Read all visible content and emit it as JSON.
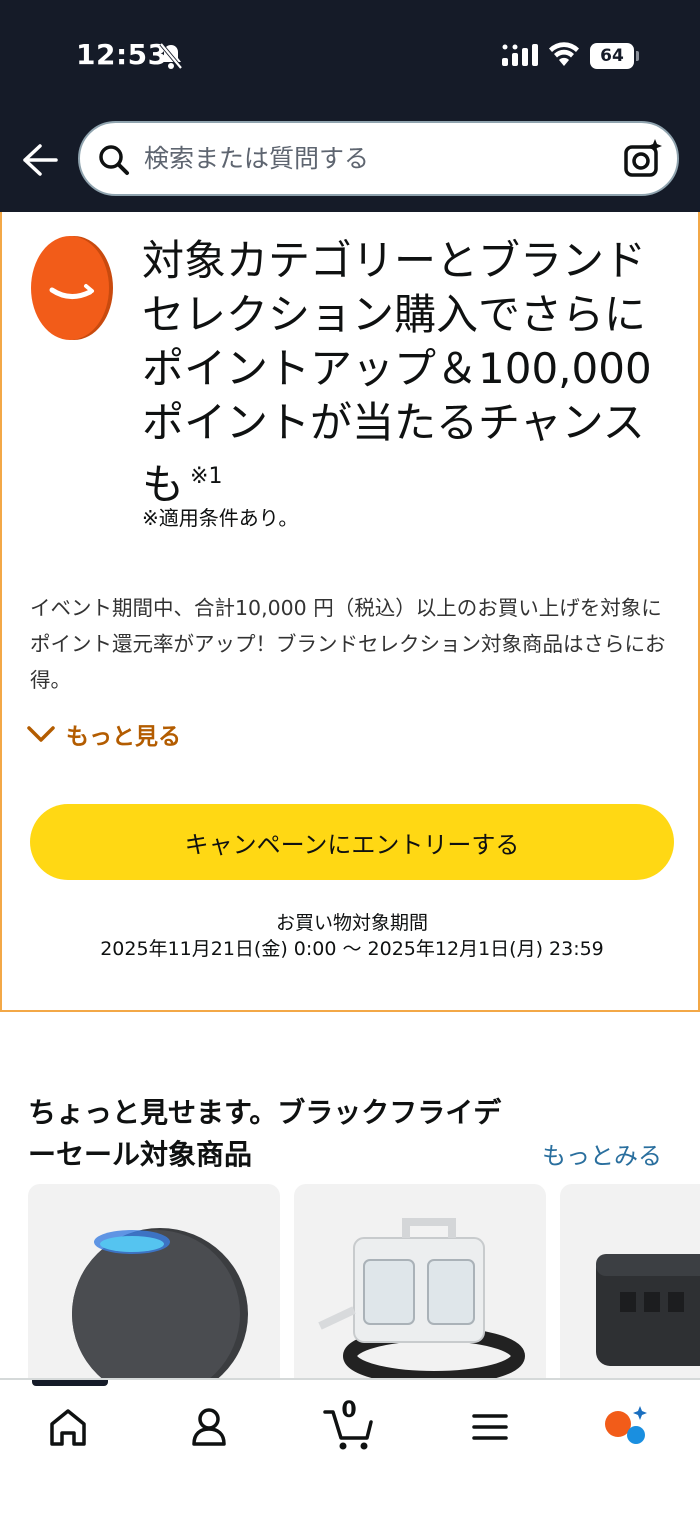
{
  "status_bar": {
    "time": "12:53",
    "battery": "64"
  },
  "search": {
    "placeholder": "検索または質問する"
  },
  "campaign": {
    "headline": "対象カテゴリーとブランドセレクション購入でさらに ポイントアップ＆100,000ポイントが当たるチャンスも",
    "headline_note": "※1",
    "condition": "※適用条件あり。",
    "description": "イベント期間中、合計10,000 円（税込）以上のお買い上げを対象にポイント還元率がアップ！ブランドセレクション対象商品はさらにお得。",
    "more_label": "もっと見る",
    "entry_button": "キャンペーンにエントリーする",
    "period_title": "お買い物対象期間",
    "period_range": "2025年11月21日(金) 0:00 〜 2025年12月1日(月) 23:59"
  },
  "section": {
    "title": "ちょっと見せます。ブラックフライデーセール対象商品",
    "more_label": "もっとみる",
    "products": [
      {
        "name": "smart-speaker-icon"
      },
      {
        "name": "carpet-cleaner-icon"
      },
      {
        "name": "portable-power-station-icon"
      }
    ]
  },
  "bottom_nav": {
    "cart_count": "0",
    "active_index": 0
  },
  "colors": {
    "header_bg": "#151b28",
    "accent_orange": "#f3a847",
    "link_orange": "#b35c00",
    "button_yellow": "#ffd814",
    "link_blue": "#2a6f9e",
    "coin_orange": "#f25c19"
  }
}
